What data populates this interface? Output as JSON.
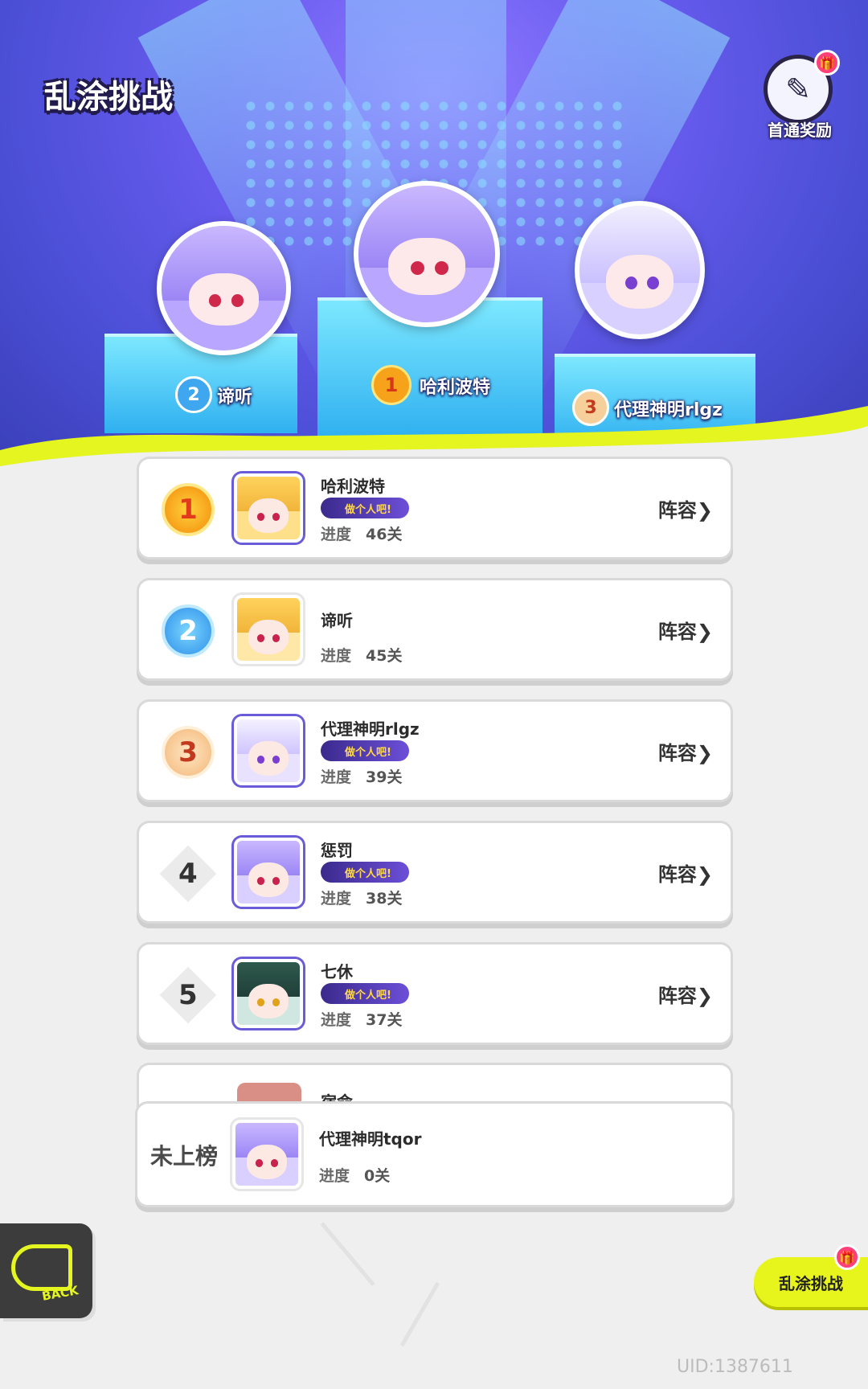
{
  "header": {
    "title": "乱涂挑战",
    "reward_label": "首通奖励"
  },
  "podium": [
    {
      "rank": "2",
      "name": "谛听"
    },
    {
      "rank": "1",
      "name": "哈利波特"
    },
    {
      "rank": "3",
      "name": "代理神明rlgz"
    }
  ],
  "leaderboard": {
    "progress_label": "进度",
    "lineup_label": "阵容",
    "rows": [
      {
        "rank": "1",
        "name": "哈利波特",
        "tag": "做个人吧!",
        "progress": "46关"
      },
      {
        "rank": "2",
        "name": "谛听",
        "tag": "",
        "progress": "45关"
      },
      {
        "rank": "3",
        "name": "代理神明rlgz",
        "tag": "做个人吧!",
        "progress": "39关"
      },
      {
        "rank": "4",
        "name": "惩罚",
        "tag": "做个人吧!",
        "progress": "38关"
      },
      {
        "rank": "5",
        "name": "七休",
        "tag": "做个人吧!",
        "progress": "37关"
      }
    ],
    "partial_row": {
      "name": "宿命"
    }
  },
  "my_entry": {
    "status": "未上榜",
    "name": "代理神明tqor",
    "progress_label": "进度",
    "progress": "0关"
  },
  "footer": {
    "back_label": "BACK",
    "challenge_button": "乱涂挑战",
    "uid": "UID:1387611"
  },
  "colors": {
    "accent_yellow": "#e8f51c",
    "stage_purple": "#6a5cf0",
    "podium_blue": "#2fb0f0"
  }
}
